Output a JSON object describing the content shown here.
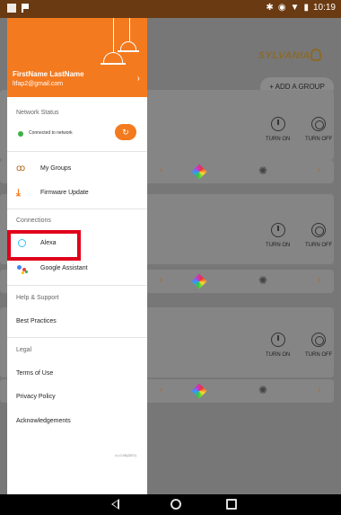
{
  "status_bar": {
    "time": "10:19",
    "icons": [
      "bluetooth-icon",
      "sync-icon",
      "wifi-icon",
      "battery-icon"
    ]
  },
  "background_app": {
    "brand": "SYLVANIA",
    "add_group_label": "+ ADD A GROUP",
    "turn_on_label": "TURN ON",
    "turn_off_label": "TURN OFF"
  },
  "drawer": {
    "user_name": "FirstName LastName",
    "user_email": "ltfap2@gmail.com",
    "network_status_label": "Network Status",
    "network_connected_text": "Connected to network",
    "menu": [
      {
        "label": "My Groups",
        "icon": "groups-icon"
      },
      {
        "label": "Firmware Update",
        "icon": "download-icon"
      }
    ],
    "connections_label": "Connections",
    "connections": [
      {
        "label": "Alexa",
        "icon": "alexa-icon"
      },
      {
        "label": "Google Assistant",
        "icon": "google-assistant-icon"
      }
    ],
    "help_label": "Help & Support",
    "best_practices": "Best Practices",
    "legal_label": "Legal",
    "terms": "Terms of Use",
    "privacy": "Privacy Policy",
    "acknowledgements": "Acknowledgements",
    "version": "v1.0.90(DEV)"
  },
  "colors": {
    "accent": "#f47a1f",
    "highlight": "#e0001a",
    "connected": "#3cb043"
  }
}
